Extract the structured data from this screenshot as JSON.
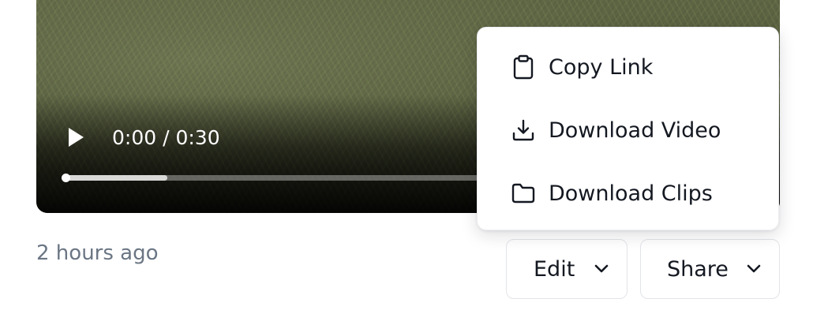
{
  "player": {
    "time_display": "0:00 / 0:30",
    "progress_fraction": 0.0,
    "buffered_fraction": 0.24
  },
  "meta": {
    "timestamp": "2 hours ago"
  },
  "buttons": {
    "edit_label": "Edit",
    "share_label": "Share"
  },
  "share_menu": {
    "items": [
      {
        "label": "Copy Link",
        "icon": "clipboard-icon"
      },
      {
        "label": "Download Video",
        "icon": "download-icon"
      },
      {
        "label": "Download Clips",
        "icon": "folder-icon"
      }
    ]
  },
  "colors": {
    "text_primary": "#141821",
    "text_muted": "#6b7684",
    "border": "#e2e4e8"
  }
}
